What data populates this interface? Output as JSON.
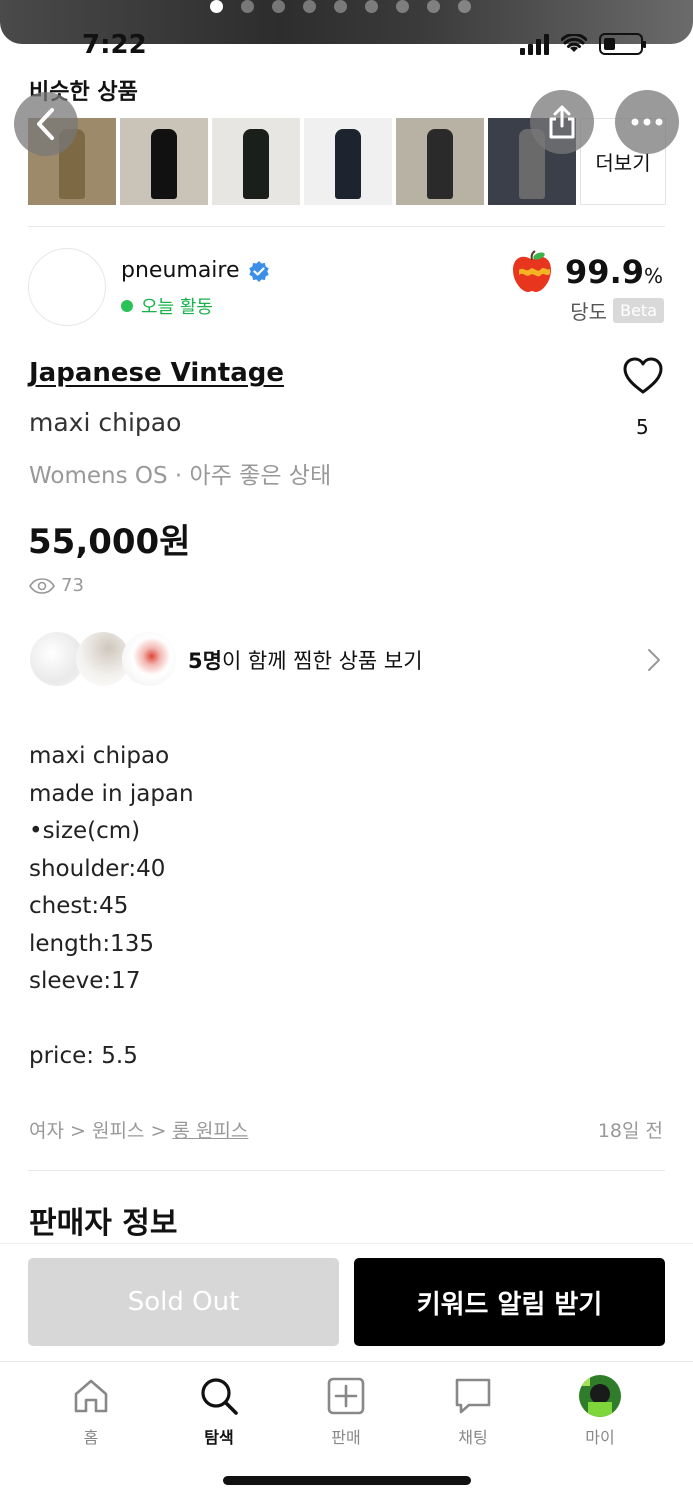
{
  "status_bar": {
    "time": "7:22"
  },
  "similar": {
    "title": "비슷한 상품",
    "more_label": "더보기",
    "thumbnails": [
      {
        "bg": "#9c8a6a",
        "fig": "#7d6a45"
      },
      {
        "bg": "#c9c3b8",
        "fig": "#111111"
      },
      {
        "bg": "#e8e6e3",
        "fig": "#1a1f1c"
      },
      {
        "bg": "#f0f0f0",
        "fig": "#1e2330"
      },
      {
        "bg": "#b8b2a4",
        "fig": "#2a2a2a"
      },
      {
        "bg": "#3a3f4a",
        "fig": "#6a6a6a"
      }
    ]
  },
  "seller": {
    "name": "pneumaire",
    "activity": "오늘 활동",
    "rating_value": "99.9",
    "rating_unit": "%",
    "rating_label": "당도",
    "beta_label": "Beta"
  },
  "product": {
    "brand": "Japanese Vintage",
    "title": "maxi chipao",
    "meta": "Womens OS · 아주 좋은 상태",
    "price": "55,000원",
    "views": "73",
    "likes": "5",
    "description": "maxi chipao\nmade in japan\n•size(cm)\nshoulder:40\nchest:45\nlength:135\nsleeve:17\n\nprice: 5.5"
  },
  "wishlist_row": {
    "count_text": "5명",
    "suffix": "이 함께 찜한 상품 보기"
  },
  "category": {
    "path_prefix": "여자 > 원피스 > ",
    "path_link": "롱 원피스",
    "posted": "18일 전"
  },
  "section": {
    "seller_info_title": "판매자 정보"
  },
  "actions": {
    "sold_out": "Sold Out",
    "keyword_alert": "키워드 알림 받기"
  },
  "tabbar": {
    "items": [
      {
        "label": "홈",
        "icon": "home-icon"
      },
      {
        "label": "탐색",
        "icon": "search-icon"
      },
      {
        "label": "판매",
        "icon": "plus-square-icon"
      },
      {
        "label": "채팅",
        "icon": "chat-icon"
      },
      {
        "label": "마이",
        "icon": "profile-avatar-icon"
      }
    ],
    "active_index": 1
  },
  "colors": {
    "accent_green": "#2cc356",
    "verified_blue": "#3b8fe8",
    "rating_apple": "#e8361e"
  }
}
